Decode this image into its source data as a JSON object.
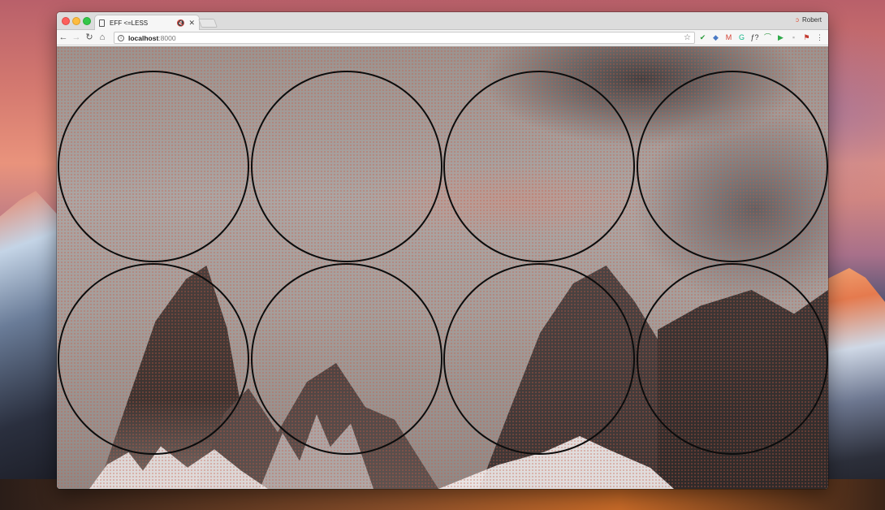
{
  "window": {
    "tab": {
      "title": "EFF <=LESS",
      "doc_icon": "document-icon",
      "mute_icon": "🔇",
      "close": "✕"
    },
    "profile": {
      "name": "Robert",
      "icon": "profile-icon"
    }
  },
  "toolbar": {
    "back": "←",
    "forward": "→",
    "reload": "↻",
    "home": "⌂",
    "address": {
      "info_icon": "i",
      "host": "localhost",
      "port": ":8000"
    },
    "star": "☆",
    "extensions": [
      {
        "name": "check-extension-icon",
        "glyph": "✔",
        "color": "#2a9a3a"
      },
      {
        "name": "diamond-extension-icon",
        "glyph": "◆",
        "color": "#4a7ac4"
      },
      {
        "name": "gmail-extension-icon",
        "glyph": "M",
        "color": "#d23f31"
      },
      {
        "name": "grammarly-extension-icon",
        "glyph": "G",
        "color": "#15b88a"
      },
      {
        "name": "function-extension-icon",
        "glyph": "ƒ?",
        "color": "#333333"
      },
      {
        "name": "wave-extension-icon",
        "glyph": "⌒",
        "color": "#3a9a4a"
      },
      {
        "name": "play-extension-icon",
        "glyph": "▶",
        "color": "#2fa94a"
      },
      {
        "name": "square-extension-icon",
        "glyph": "▪",
        "color": "#bbbbbb"
      },
      {
        "name": "puzzle-extension-icon",
        "glyph": "⚑",
        "color": "#c23a30"
      },
      {
        "name": "menu-icon",
        "glyph": "⋮",
        "color": "#555555"
      }
    ]
  },
  "content": {
    "circles": 8,
    "circle_color": "#0c0c0c",
    "halftone_color": "#c85a46"
  }
}
